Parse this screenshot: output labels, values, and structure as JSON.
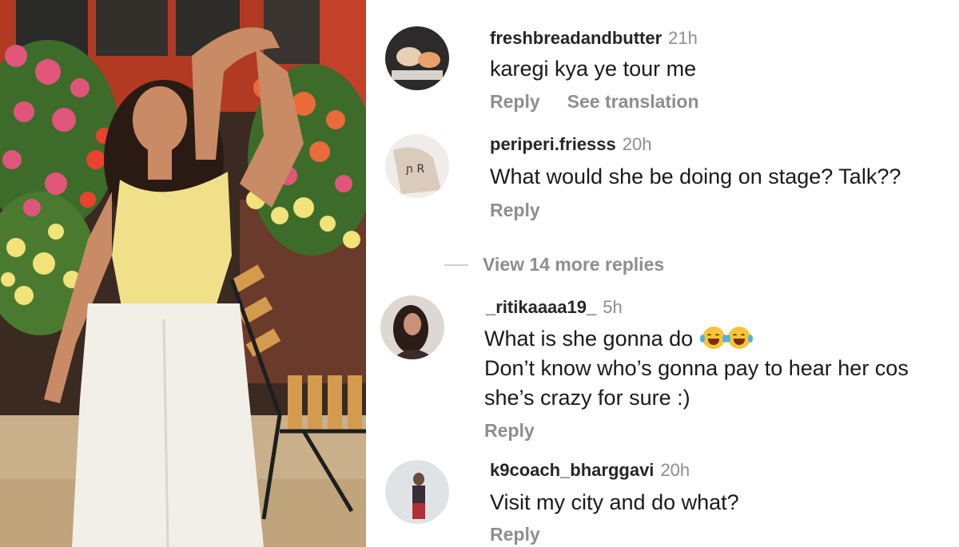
{
  "comments": [
    {
      "username": "freshbreadandbutter",
      "time": "21h",
      "text": "karegi kya ye tour me",
      "reply_label": "Reply",
      "translate_label": "See translation"
    },
    {
      "username": "periperi.friesss",
      "time": "20h",
      "text": "What would she be doing on stage? Talk??",
      "reply_label": "Reply"
    },
    {
      "username": "_ritikaaaa19_",
      "time": "5h",
      "text_line1": "What is she gonna do",
      "text_line1_emoji": "😂😂",
      "text_line2": "Don’t know who’s gonna pay to hear her cos",
      "text_line3": "she’s crazy for sure :)",
      "reply_label": "Reply"
    },
    {
      "username": "k9coach_bharggavi",
      "time": "20h",
      "text": "Visit my city and do what?",
      "reply_label": "Reply"
    }
  ],
  "view_more_replies": "View 14 more replies",
  "colors": {
    "username": "#262626",
    "meta": "#8e8e8e",
    "text": "#1a1a1a",
    "background": "#ffffff"
  }
}
